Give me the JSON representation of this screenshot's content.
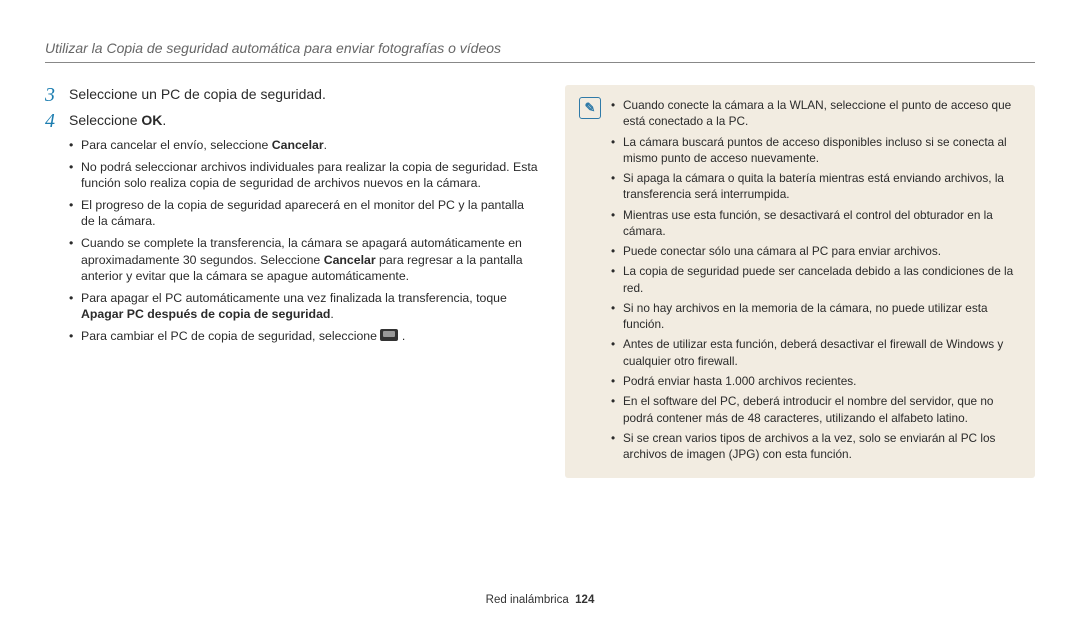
{
  "header": {
    "title": "Utilizar la Copia de seguridad automática para enviar fotografías o vídeos"
  },
  "steps": {
    "s3": {
      "num": "3",
      "text": "Seleccione un PC de copia de seguridad."
    },
    "s4": {
      "num": "4",
      "text_a": "Seleccione ",
      "text_b": "OK",
      "text_c": "."
    }
  },
  "sub": {
    "i1a": "Para cancelar el envío, seleccione ",
    "i1b": "Cancelar",
    "i1c": ".",
    "i2": "No podrá seleccionar archivos individuales para realizar la copia de seguridad. Esta función solo realiza copia de seguridad de archivos nuevos en la cámara.",
    "i3": "El progreso de la copia de seguridad aparecerá en el monitor del PC y la pantalla de la cámara.",
    "i4a": "Cuando se complete la transferencia, la cámara se apagará automáticamente en aproximadamente 30 segundos. Seleccione ",
    "i4b": "Cancelar",
    "i4c": " para regresar a la pantalla anterior y evitar que la cámara se apague automáticamente.",
    "i5a": "Para apagar el PC automáticamente una vez finalizada la transferencia, toque ",
    "i5b": "Apagar PC después de copia de seguridad",
    "i5c": ".",
    "i6a": "Para cambiar el PC de copia de seguridad, seleccione ",
    "i6b": " ."
  },
  "notes": {
    "n1": "Cuando conecte la cámara a la WLAN, seleccione el punto de acceso que está conectado a la PC.",
    "n2": "La cámara buscará puntos de acceso disponibles incluso si se conecta al mismo punto de acceso nuevamente.",
    "n3": "Si apaga la cámara o quita la batería mientras está enviando archivos, la transferencia será interrumpida.",
    "n4": "Mientras use esta función, se desactivará el control del obturador en la cámara.",
    "n5": "Puede conectar sólo una cámara al PC para enviar archivos.",
    "n6": "La copia de seguridad puede ser cancelada debido a las condiciones de la red.",
    "n7": "Si no hay archivos en la memoria de la cámara, no puede utilizar esta función.",
    "n8": "Antes de utilizar esta función, deberá desactivar el firewall de Windows y cualquier otro firewall.",
    "n9": "Podrá enviar hasta 1.000 archivos recientes.",
    "n10": "En el software del PC, deberá introducir el nombre del servidor, que no podrá contener más de 48 caracteres, utilizando el alfabeto latino.",
    "n11": "Si se crean varios tipos de archivos a la vez, solo se enviarán al PC los archivos de imagen (JPG) con esta función."
  },
  "footer": {
    "section": "Red inalámbrica",
    "page": "124"
  },
  "note_icon_label": "✎"
}
